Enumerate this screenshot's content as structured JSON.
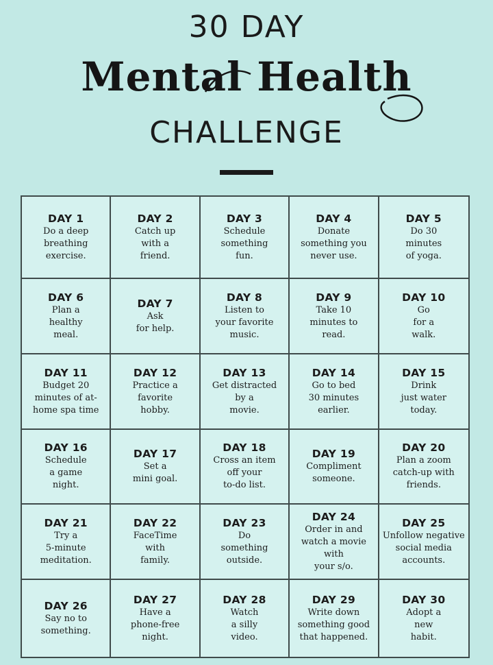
{
  "header": {
    "line1": "30 DAY",
    "line2": "Mental Health",
    "line3": "CHALLENGE"
  },
  "days": [
    {
      "label": "DAY 1",
      "task": "Do a deep\nbreathing\nexercise."
    },
    {
      "label": "DAY 2",
      "task": "Catch up\nwith a\nfriend."
    },
    {
      "label": "DAY 3",
      "task": "Schedule\nsomething\nfun."
    },
    {
      "label": "DAY 4",
      "task": "Donate\nsomething you\nnever use."
    },
    {
      "label": "DAY 5",
      "task": "Do 30\nminutes\nof yoga."
    },
    {
      "label": "DAY 6",
      "task": "Plan a\nhealthy\nmeal."
    },
    {
      "label": "DAY 7",
      "task": "Ask\nfor help."
    },
    {
      "label": "DAY 8",
      "task": "Listen to\nyour favorite\nmusic."
    },
    {
      "label": "DAY 9",
      "task": "Take 10\nminutes to\nread."
    },
    {
      "label": "DAY 10",
      "task": "Go\nfor a\nwalk."
    },
    {
      "label": "DAY 11",
      "task": "Budget 20\nminutes of at-\nhome spa time"
    },
    {
      "label": "DAY 12",
      "task": "Practice a\nfavorite\nhobby."
    },
    {
      "label": "DAY 13",
      "task": "Get distracted\nby a\nmovie."
    },
    {
      "label": "DAY 14",
      "task": "Go to bed\n30 minutes\nearlier."
    },
    {
      "label": "DAY 15",
      "task": "Drink\njust water\ntoday."
    },
    {
      "label": "DAY 16",
      "task": "Schedule\na game\nnight."
    },
    {
      "label": "DAY 17",
      "task": "Set a\nmini goal."
    },
    {
      "label": "DAY 18",
      "task": "Cross an item\noff your\nto-do list."
    },
    {
      "label": "DAY 19",
      "task": "Compliment\nsomeone."
    },
    {
      "label": "DAY 20",
      "task": "Plan a zoom\ncatch-up with\nfriends."
    },
    {
      "label": "DAY 21",
      "task": "Try a\n5-minute\nmeditation."
    },
    {
      "label": "DAY 22",
      "task": "FaceTime\nwith\nfamily."
    },
    {
      "label": "DAY 23",
      "task": "Do\nsomething\noutside."
    },
    {
      "label": "DAY 24",
      "task": "Order in and\nwatch a movie with\nyour s/o."
    },
    {
      "label": "DAY 25",
      "task": "Unfollow negative\nsocial media\naccounts."
    },
    {
      "label": "DAY 26",
      "task": "Say no to\nsomething."
    },
    {
      "label": "DAY 27",
      "task": "Have a\nphone-free\nnight."
    },
    {
      "label": "DAY 28",
      "task": "Watch\na silly\nvideo."
    },
    {
      "label": "DAY 29",
      "task": "Write down\nsomething good\nthat happened."
    },
    {
      "label": "DAY 30",
      "task": "Adopt a\nnew\nhabit."
    }
  ]
}
